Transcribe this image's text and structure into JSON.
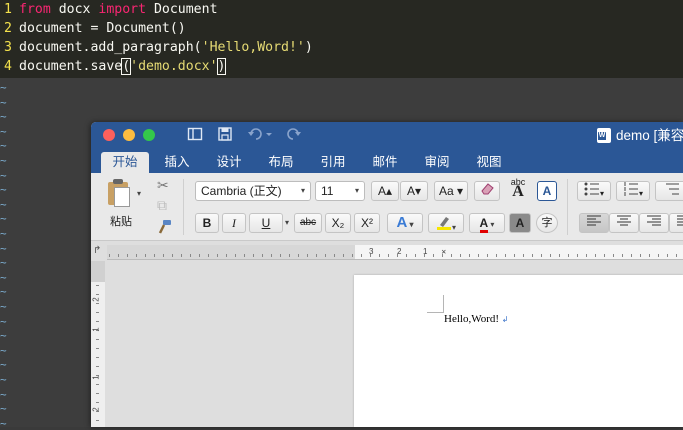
{
  "editor": {
    "lines": [
      {
        "num": "1",
        "parts": [
          {
            "t": "from",
            "c": "kw"
          },
          {
            "t": " docx ",
            "c": ""
          },
          {
            "t": "import",
            "c": "kw"
          },
          {
            "t": " Document",
            "c": ""
          }
        ]
      },
      {
        "num": "2",
        "parts": [
          {
            "t": "document = Document()",
            "c": ""
          }
        ]
      },
      {
        "num": "3",
        "parts": [
          {
            "t": "document.add_paragraph(",
            "c": ""
          },
          {
            "t": "'Hello,Word!'",
            "c": "str"
          },
          {
            "t": ")",
            "c": ""
          }
        ]
      },
      {
        "num": "4",
        "parts": [
          {
            "t": "document.save",
            "c": ""
          },
          {
            "t": "(",
            "c": "bracket"
          },
          {
            "t": "'demo.docx'",
            "c": "str"
          },
          {
            "t": ")",
            "c": "bracket"
          }
        ]
      }
    ],
    "tilde": "~"
  },
  "word": {
    "title": "demo [兼容",
    "doc_icon_letter": "W",
    "tabs": [
      "开始",
      "插入",
      "设计",
      "布局",
      "引用",
      "邮件",
      "审阅",
      "视图"
    ],
    "active_tab": "开始",
    "ribbon": {
      "paste_label": "粘贴",
      "font_name": "Cambria (正文)",
      "font_size": "11",
      "grow_font": "A▴",
      "shrink_font": "A▾",
      "case_label": "Aa",
      "bold": "B",
      "italic": "I",
      "underline": "U",
      "strikethrough": "abc",
      "subscript": "X₂",
      "superscript": "X²",
      "text_effects": "A",
      "font_color": "A",
      "char_shading": "A",
      "enclose_char": "字",
      "abc_label": "abc",
      "style_a": "A"
    },
    "ruler_numbers_v": [
      "2",
      "1",
      "1",
      "2"
    ],
    "ruler_numbers_h": [
      "3",
      "2",
      "1"
    ],
    "document_text": "Hello,Word!",
    "colors": {
      "accent": "#2b5796",
      "highlight": "#f7e600",
      "font_color_bar": "#e00000"
    }
  }
}
